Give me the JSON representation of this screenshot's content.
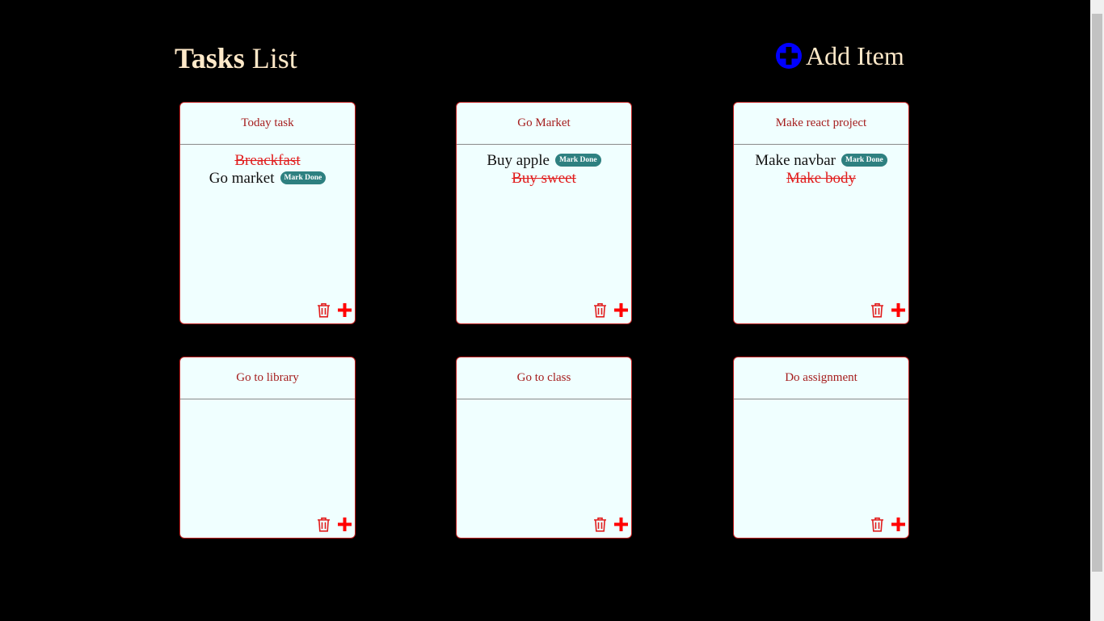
{
  "header": {
    "title_bold": "Tasks",
    "title_rest": "List",
    "add_item_label": "Add Item"
  },
  "colors": {
    "background": "#000000",
    "card_background": "#f0ffff",
    "card_border": "#c21e1e",
    "done_text": "#e11d1d",
    "badge": "#2e8080",
    "add_icon": "#0000ff",
    "header_text": "#ffe9c9"
  },
  "mark_done_label": "Mark Done",
  "cards": [
    {
      "title": "Today task",
      "tasks": [
        {
          "text": "Breackfast",
          "done": true
        },
        {
          "text": "Go market",
          "done": false
        }
      ]
    },
    {
      "title": "Go Market",
      "tasks": [
        {
          "text": "Buy apple",
          "done": false
        },
        {
          "text": "Buy sweet",
          "done": true
        }
      ]
    },
    {
      "title": "Make react project",
      "tasks": [
        {
          "text": "Make navbar",
          "done": false
        },
        {
          "text": "Make body",
          "done": true
        }
      ]
    },
    {
      "title": "Go to library",
      "tasks": []
    },
    {
      "title": "Go to class",
      "tasks": []
    },
    {
      "title": "Do assignment",
      "tasks": []
    }
  ]
}
